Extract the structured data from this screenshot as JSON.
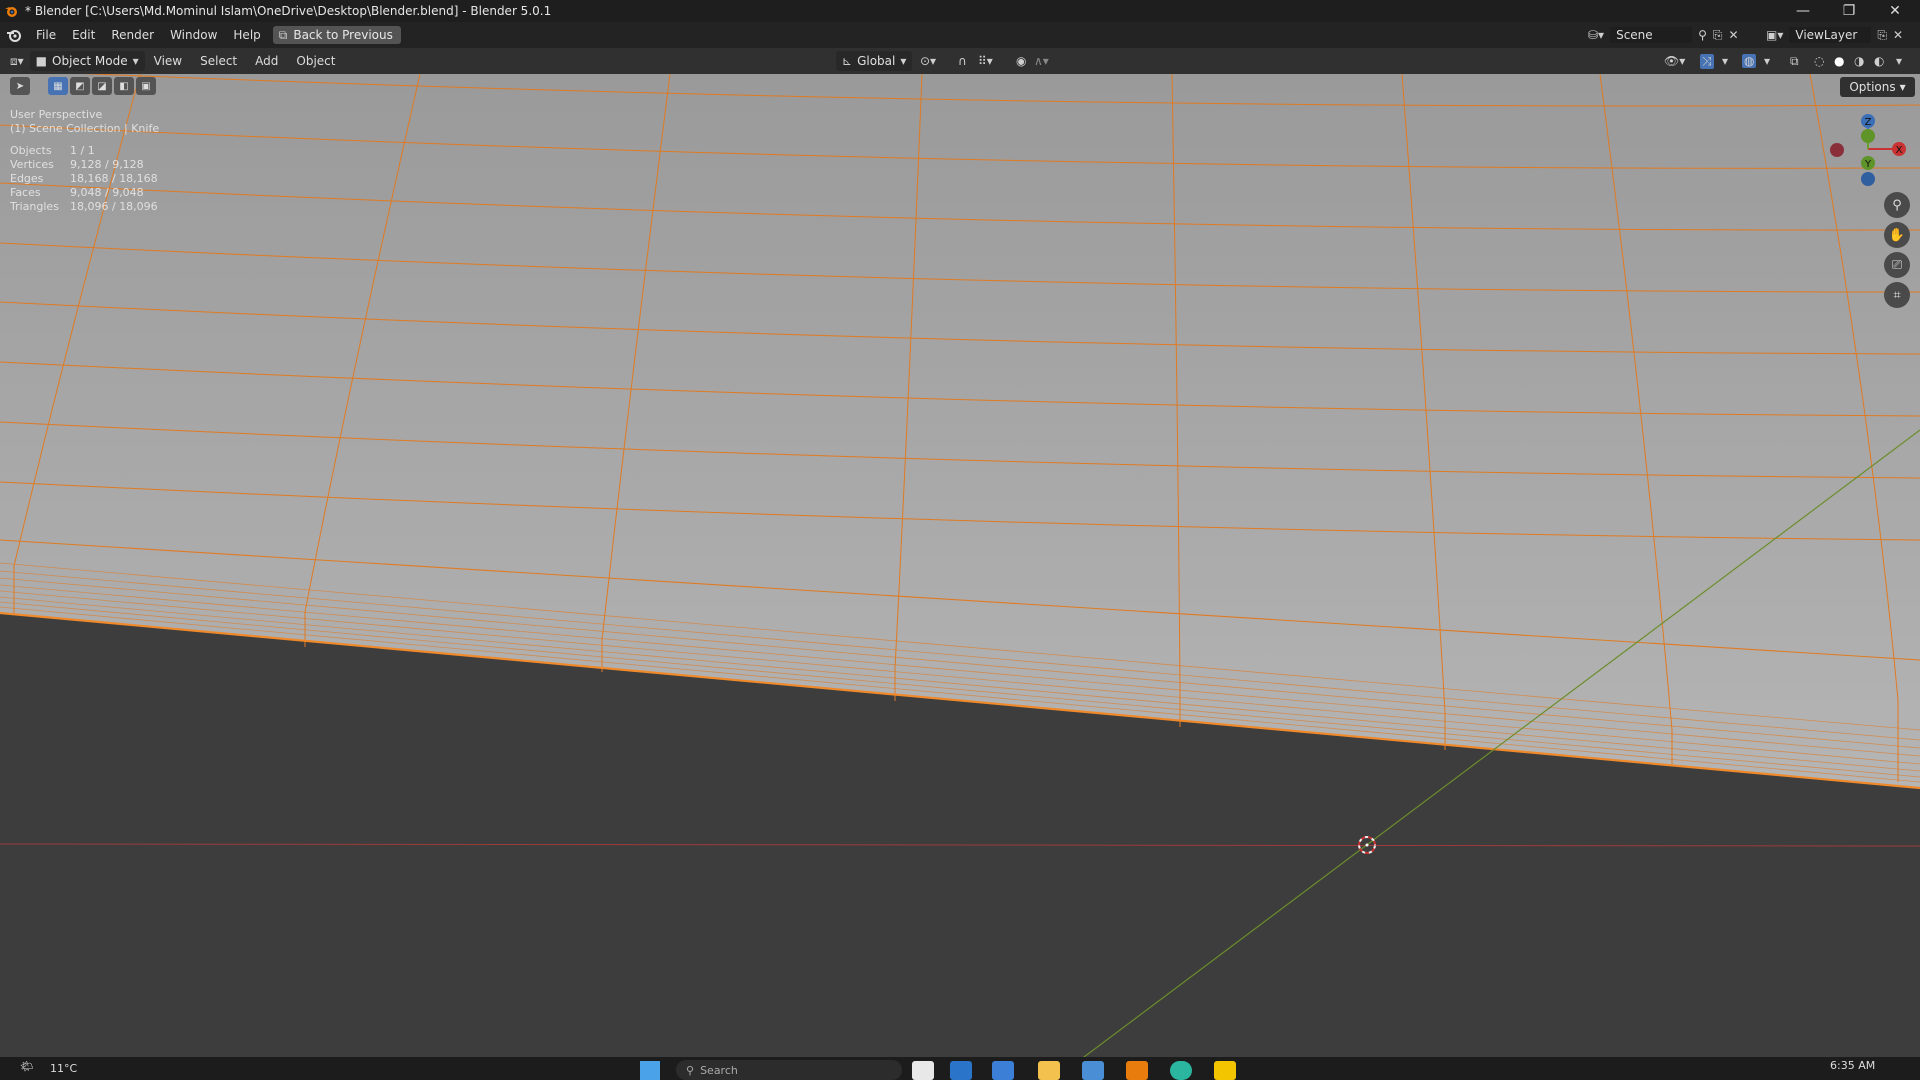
{
  "window": {
    "title": "* Blender [C:\\Users\\Md.Mominul Islam\\OneDrive\\Desktop\\Blender.blend] - Blender 5.0.1",
    "controls": {
      "minimize": "—",
      "maximize": "❐",
      "close": "✕"
    }
  },
  "menubar": {
    "items": [
      {
        "label": "File"
      },
      {
        "label": "Edit"
      },
      {
        "label": "Render"
      },
      {
        "label": "Window"
      },
      {
        "label": "Help"
      }
    ],
    "back_button": "Back to Previous",
    "scene": "Scene",
    "view_layer": "ViewLayer"
  },
  "viewport_header": {
    "mode": "Object Mode",
    "menus": [
      {
        "label": "View"
      },
      {
        "label": "Select"
      },
      {
        "label": "Add"
      },
      {
        "label": "Object"
      }
    ],
    "transform_orientation": "Global"
  },
  "viewport": {
    "options_label": "Options",
    "perspective_label": "User Perspective",
    "collection_label": "(1) Scene Collection | Knife",
    "stats": [
      {
        "label": "Objects",
        "value": "1 / 1"
      },
      {
        "label": "Vertices",
        "value": "9,128 / 9,128"
      },
      {
        "label": "Edges",
        "value": "18,168 / 18,168"
      },
      {
        "label": "Faces",
        "value": "9,048 / 9,048"
      },
      {
        "label": "Triangles",
        "value": "18,096 / 18,096"
      }
    ],
    "gizmo_axes": {
      "x": "X",
      "y": "Y",
      "z": "Z"
    },
    "colors": {
      "mesh_surface": "#a9a9a9",
      "wire": "#e3781f",
      "x_axis": "#b83a3a",
      "y_axis": "#6b8e2a",
      "background": "#3d3d3d"
    }
  },
  "taskbar": {
    "temperature": "11°C",
    "search_placeholder": "Search",
    "time": "6:35 AM"
  }
}
